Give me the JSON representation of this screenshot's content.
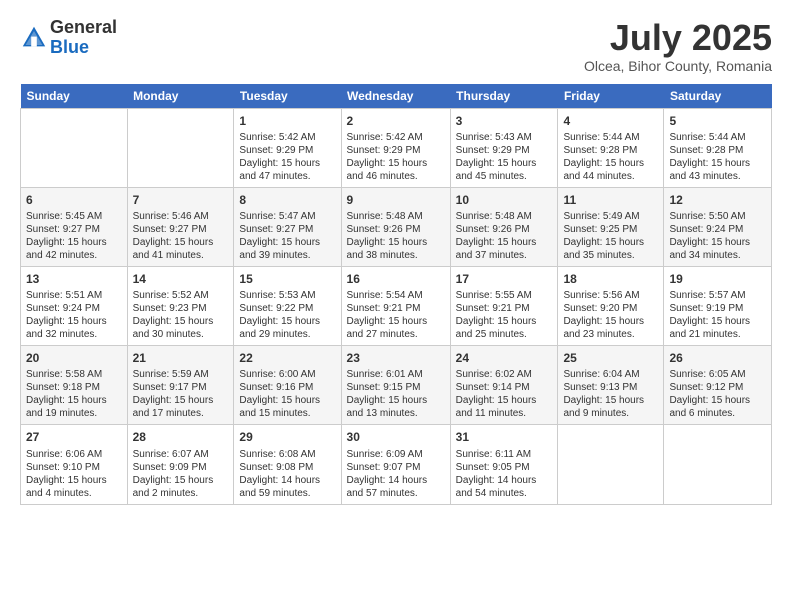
{
  "header": {
    "logo_general": "General",
    "logo_blue": "Blue",
    "month_title": "July 2025",
    "location": "Olcea, Bihor County, Romania"
  },
  "days_of_week": [
    "Sunday",
    "Monday",
    "Tuesday",
    "Wednesday",
    "Thursday",
    "Friday",
    "Saturday"
  ],
  "weeks": [
    [
      {
        "day": "",
        "info": ""
      },
      {
        "day": "",
        "info": ""
      },
      {
        "day": "1",
        "info": "Sunrise: 5:42 AM\nSunset: 9:29 PM\nDaylight: 15 hours and 47 minutes."
      },
      {
        "day": "2",
        "info": "Sunrise: 5:42 AM\nSunset: 9:29 PM\nDaylight: 15 hours and 46 minutes."
      },
      {
        "day": "3",
        "info": "Sunrise: 5:43 AM\nSunset: 9:29 PM\nDaylight: 15 hours and 45 minutes."
      },
      {
        "day": "4",
        "info": "Sunrise: 5:44 AM\nSunset: 9:28 PM\nDaylight: 15 hours and 44 minutes."
      },
      {
        "day": "5",
        "info": "Sunrise: 5:44 AM\nSunset: 9:28 PM\nDaylight: 15 hours and 43 minutes."
      }
    ],
    [
      {
        "day": "6",
        "info": "Sunrise: 5:45 AM\nSunset: 9:27 PM\nDaylight: 15 hours and 42 minutes."
      },
      {
        "day": "7",
        "info": "Sunrise: 5:46 AM\nSunset: 9:27 PM\nDaylight: 15 hours and 41 minutes."
      },
      {
        "day": "8",
        "info": "Sunrise: 5:47 AM\nSunset: 9:27 PM\nDaylight: 15 hours and 39 minutes."
      },
      {
        "day": "9",
        "info": "Sunrise: 5:48 AM\nSunset: 9:26 PM\nDaylight: 15 hours and 38 minutes."
      },
      {
        "day": "10",
        "info": "Sunrise: 5:48 AM\nSunset: 9:26 PM\nDaylight: 15 hours and 37 minutes."
      },
      {
        "day": "11",
        "info": "Sunrise: 5:49 AM\nSunset: 9:25 PM\nDaylight: 15 hours and 35 minutes."
      },
      {
        "day": "12",
        "info": "Sunrise: 5:50 AM\nSunset: 9:24 PM\nDaylight: 15 hours and 34 minutes."
      }
    ],
    [
      {
        "day": "13",
        "info": "Sunrise: 5:51 AM\nSunset: 9:24 PM\nDaylight: 15 hours and 32 minutes."
      },
      {
        "day": "14",
        "info": "Sunrise: 5:52 AM\nSunset: 9:23 PM\nDaylight: 15 hours and 30 minutes."
      },
      {
        "day": "15",
        "info": "Sunrise: 5:53 AM\nSunset: 9:22 PM\nDaylight: 15 hours and 29 minutes."
      },
      {
        "day": "16",
        "info": "Sunrise: 5:54 AM\nSunset: 9:21 PM\nDaylight: 15 hours and 27 minutes."
      },
      {
        "day": "17",
        "info": "Sunrise: 5:55 AM\nSunset: 9:21 PM\nDaylight: 15 hours and 25 minutes."
      },
      {
        "day": "18",
        "info": "Sunrise: 5:56 AM\nSunset: 9:20 PM\nDaylight: 15 hours and 23 minutes."
      },
      {
        "day": "19",
        "info": "Sunrise: 5:57 AM\nSunset: 9:19 PM\nDaylight: 15 hours and 21 minutes."
      }
    ],
    [
      {
        "day": "20",
        "info": "Sunrise: 5:58 AM\nSunset: 9:18 PM\nDaylight: 15 hours and 19 minutes."
      },
      {
        "day": "21",
        "info": "Sunrise: 5:59 AM\nSunset: 9:17 PM\nDaylight: 15 hours and 17 minutes."
      },
      {
        "day": "22",
        "info": "Sunrise: 6:00 AM\nSunset: 9:16 PM\nDaylight: 15 hours and 15 minutes."
      },
      {
        "day": "23",
        "info": "Sunrise: 6:01 AM\nSunset: 9:15 PM\nDaylight: 15 hours and 13 minutes."
      },
      {
        "day": "24",
        "info": "Sunrise: 6:02 AM\nSunset: 9:14 PM\nDaylight: 15 hours and 11 minutes."
      },
      {
        "day": "25",
        "info": "Sunrise: 6:04 AM\nSunset: 9:13 PM\nDaylight: 15 hours and 9 minutes."
      },
      {
        "day": "26",
        "info": "Sunrise: 6:05 AM\nSunset: 9:12 PM\nDaylight: 15 hours and 6 minutes."
      }
    ],
    [
      {
        "day": "27",
        "info": "Sunrise: 6:06 AM\nSunset: 9:10 PM\nDaylight: 15 hours and 4 minutes."
      },
      {
        "day": "28",
        "info": "Sunrise: 6:07 AM\nSunset: 9:09 PM\nDaylight: 15 hours and 2 minutes."
      },
      {
        "day": "29",
        "info": "Sunrise: 6:08 AM\nSunset: 9:08 PM\nDaylight: 14 hours and 59 minutes."
      },
      {
        "day": "30",
        "info": "Sunrise: 6:09 AM\nSunset: 9:07 PM\nDaylight: 14 hours and 57 minutes."
      },
      {
        "day": "31",
        "info": "Sunrise: 6:11 AM\nSunset: 9:05 PM\nDaylight: 14 hours and 54 minutes."
      },
      {
        "day": "",
        "info": ""
      },
      {
        "day": "",
        "info": ""
      }
    ]
  ]
}
